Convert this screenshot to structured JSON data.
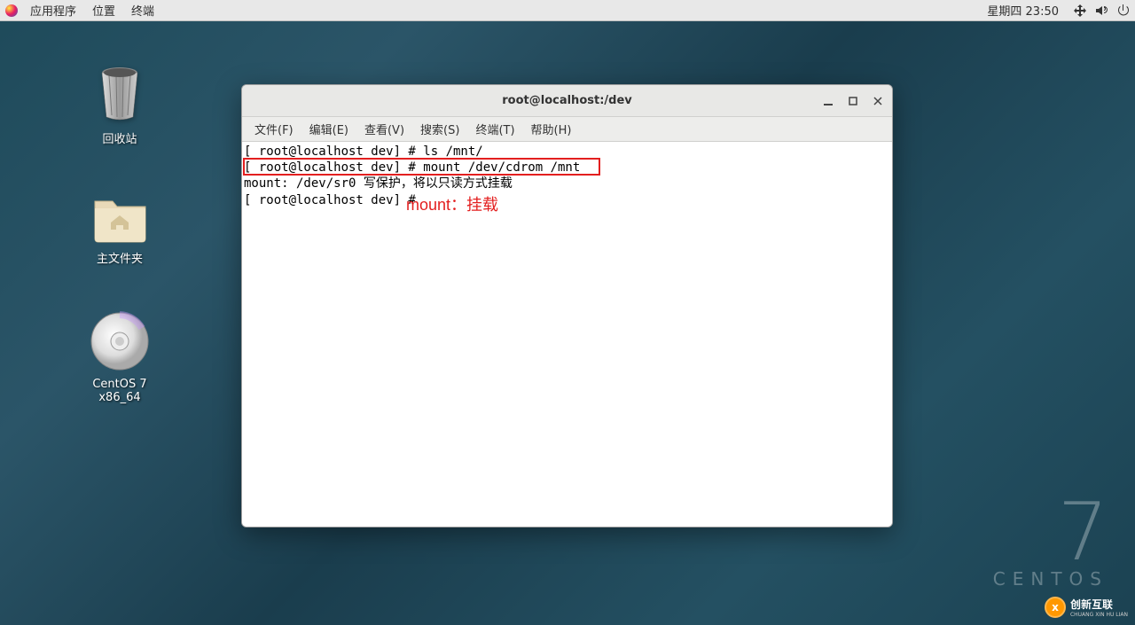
{
  "topbar": {
    "applications": "应用程序",
    "places": "位置",
    "terminal": "终端",
    "clock": "星期四 23:50"
  },
  "desktop": {
    "trash": "回收站",
    "home": "主文件夹",
    "cdrom": "CentOS 7 x86_64"
  },
  "centos": {
    "seven": "7",
    "name": "CENTOS"
  },
  "watermark": {
    "text": "创新互联",
    "subtext": "CHUANG XIN HU LIAN"
  },
  "terminal": {
    "title": "root@localhost:/dev",
    "menu": {
      "file": "文件(F)",
      "edit": "编辑(E)",
      "view": "查看(V)",
      "search": "搜索(S)",
      "terminal_m": "终端(T)",
      "help": "帮助(H)"
    },
    "lines": {
      "l1": "[ root@localhost dev] # ls /mnt/",
      "l2": "[ root@localhost dev] # mount /dev/cdrom /mnt ",
      "l3": "mount: /dev/sr0 写保护，将以只读方式挂载",
      "l4": "[ root@localhost dev] # "
    },
    "annotation": "mount：挂载"
  }
}
